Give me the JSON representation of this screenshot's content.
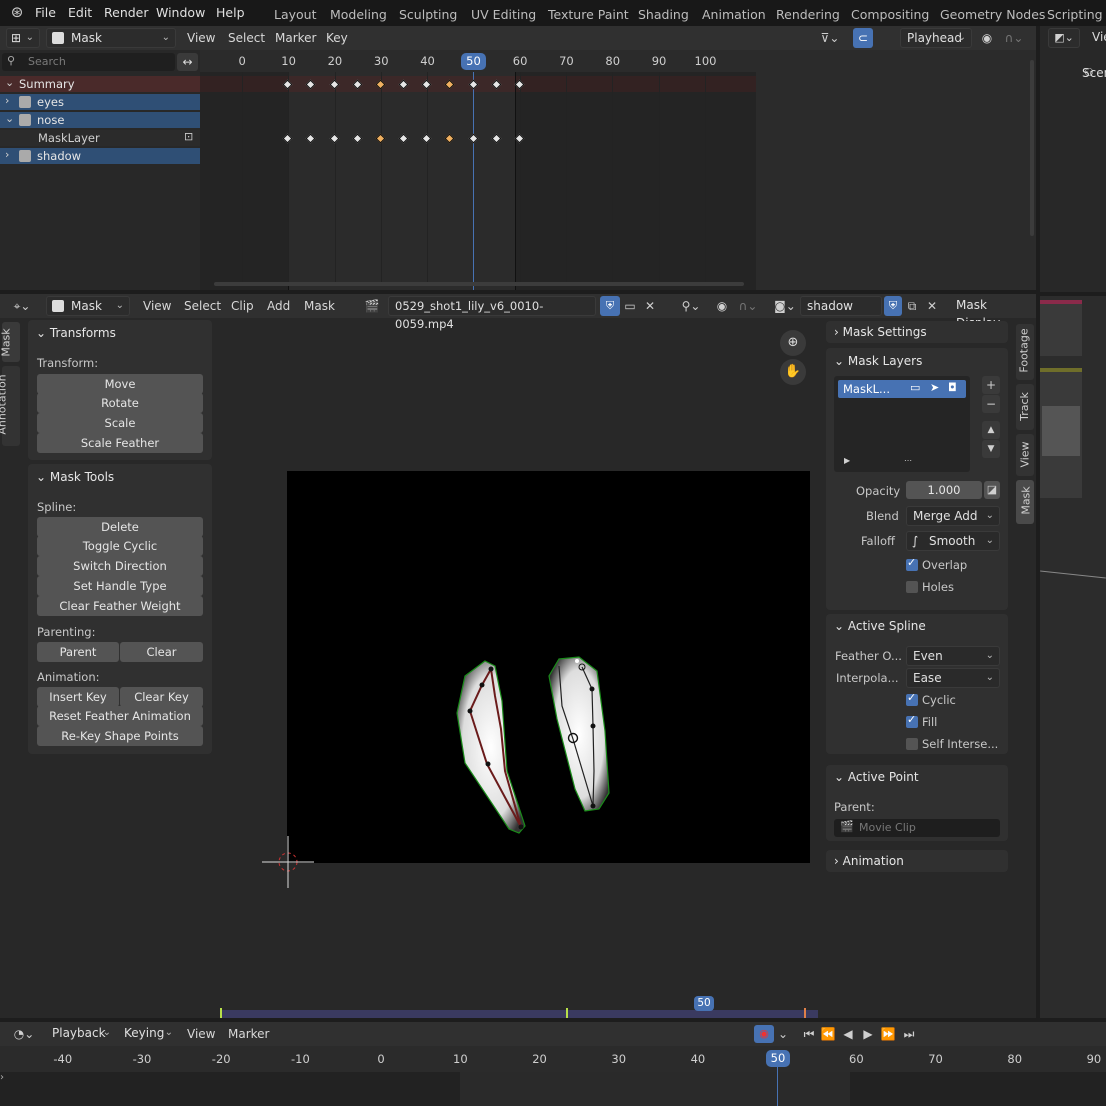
{
  "menu": {
    "file": "File",
    "edit": "Edit",
    "render": "Render",
    "window": "Window",
    "help": "Help"
  },
  "workspaces": [
    "Layout",
    "Modeling",
    "Sculpting",
    "UV Editing",
    "Texture Paint",
    "Shading",
    "Animation",
    "Rendering",
    "Compositing",
    "Geometry Nodes",
    "Scripting"
  ],
  "dopesheet": {
    "mode": "Mask",
    "menus": [
      "View",
      "Select",
      "Marker",
      "Key"
    ],
    "playhead_label": "Playhead",
    "search_placeholder": "Search",
    "ruler": [
      "0",
      "10",
      "20",
      "30",
      "40",
      "50",
      "60",
      "70",
      "80",
      "90",
      "100"
    ],
    "current_frame": "50",
    "channels": [
      {
        "label": "Summary",
        "type": "summary"
      },
      {
        "label": "eyes",
        "type": "layer"
      },
      {
        "label": "nose",
        "type": "layer"
      },
      {
        "label": "MaskLayer",
        "type": "sub"
      },
      {
        "label": "shadow",
        "type": "layer"
      }
    ],
    "keyframes_summary": [
      10,
      15,
      20,
      25,
      30,
      35,
      40,
      45,
      50,
      55,
      60
    ],
    "keyframes_masklayer": [
      10,
      15,
      20,
      25,
      30,
      35,
      40,
      45,
      50,
      55,
      60
    ],
    "selected_keys": [
      30,
      45
    ]
  },
  "clip_editor": {
    "mode": "Mask",
    "menus": [
      "View",
      "Select",
      "Clip",
      "Add",
      "Mask"
    ],
    "clip_name": "0529_shot1_lily_v6_0010-0059.mp4",
    "mask_name": "shadow",
    "mask_display": "Mask Display",
    "scrub_frame": "50"
  },
  "toolbar": {
    "transforms_title": "Transforms",
    "transform_label": "Transform:",
    "transform_buttons": [
      "Move",
      "Rotate",
      "Scale",
      "Scale Feather"
    ],
    "mask_tools_title": "Mask Tools",
    "spline_label": "Spline:",
    "spline_buttons": [
      "Delete",
      "Toggle Cyclic",
      "Switch Direction",
      "Set Handle Type",
      "Clear Feather Weight"
    ],
    "parenting_label": "Parenting:",
    "parent_btn": "Parent",
    "clear_btn": "Clear",
    "animation_label": "Animation:",
    "insert_key": "Insert Key",
    "clear_key": "Clear Key",
    "reset_feather": "Reset Feather Animation",
    "rekey": "Re-Key Shape Points"
  },
  "left_tabs": [
    "Mask",
    "Annotation"
  ],
  "right_tabs": [
    "Footage",
    "Track",
    "View",
    "Mask"
  ],
  "sidebar": {
    "mask_settings": "Mask Settings",
    "mask_layers": "Mask Layers",
    "layer_item": "MaskL...",
    "opacity_label": "Opacity",
    "opacity_value": "1.000",
    "blend_label": "Blend",
    "blend_value": "Merge Add",
    "falloff_label": "Falloff",
    "falloff_value": "Smooth",
    "overlap": "Overlap",
    "holes": "Holes",
    "active_spline": "Active Spline",
    "feather_label": "Feather O...",
    "feather_value": "Even",
    "interp_label": "Interpola...",
    "interp_value": "Ease",
    "cyclic": "Cyclic",
    "fill": "Fill",
    "self_intersect": "Self Interse...",
    "active_point": "Active Point",
    "parent_label": "Parent:",
    "parent_placeholder": "Movie Clip",
    "animation": "Animation"
  },
  "timeline": {
    "menus": [
      "Playback",
      "Keying",
      "View",
      "Marker"
    ],
    "ruler": [
      "-40",
      "-30",
      "-20",
      "-10",
      "0",
      "10",
      "20",
      "30",
      "40",
      "50",
      "60",
      "70",
      "80",
      "90"
    ],
    "current_frame": "50"
  },
  "scene_label": "Scen",
  "view_label": "Vie",
  "colors": {
    "accent": "#4772b3",
    "selected_channel": "#2f4f75",
    "summary": "#4a2a2a",
    "mask_outline": "#00aa00"
  }
}
